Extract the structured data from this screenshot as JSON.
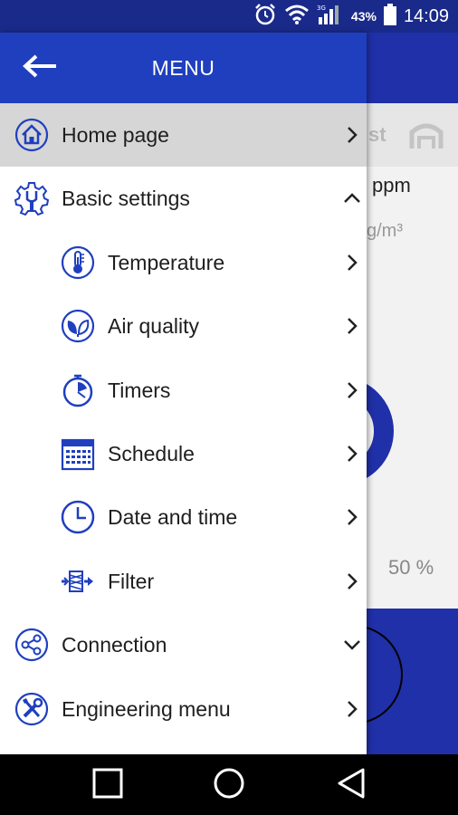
{
  "status_bar": {
    "battery_percent": "43%",
    "time": "14:09",
    "icons": [
      "alarm-icon",
      "wifi-icon",
      "signal-icon",
      "battery-icon"
    ]
  },
  "background_screen": {
    "tab_text": "st",
    "ppm_label": "ppm",
    "unit_label": "g/m³",
    "percent_label": "50 %"
  },
  "drawer": {
    "title": "MENU",
    "back_icon": "arrow-left-icon",
    "items": [
      {
        "label": "Home page",
        "icon": "home-icon",
        "chevron": "right",
        "active": true
      },
      {
        "label": "Basic settings",
        "icon": "gear-icon",
        "chevron": "up"
      },
      {
        "label": "Temperature",
        "icon": "thermometer-icon",
        "chevron": "right"
      },
      {
        "label": "Air quality",
        "icon": "leaf-icon",
        "chevron": "right"
      },
      {
        "label": "Timers",
        "icon": "stopwatch-icon",
        "chevron": "right"
      },
      {
        "label": "Schedule",
        "icon": "calendar-icon",
        "chevron": "right"
      },
      {
        "label": "Date and time",
        "icon": "clock-icon",
        "chevron": "right"
      },
      {
        "label": "Filter",
        "icon": "filter-icon",
        "chevron": "right"
      },
      {
        "label": "Connection",
        "icon": "share-icon",
        "chevron": "down"
      },
      {
        "label": "Engineering menu",
        "icon": "tools-icon",
        "chevron": "right"
      }
    ]
  },
  "colors": {
    "primary": "#1f3fbf",
    "dark_primary": "#1a2a8a",
    "icon": "#1f3fbf",
    "active_row": "#d6d6d6"
  },
  "nav_bar": {
    "buttons": [
      "recents-icon",
      "home-circle-icon",
      "back-triangle-icon"
    ]
  }
}
